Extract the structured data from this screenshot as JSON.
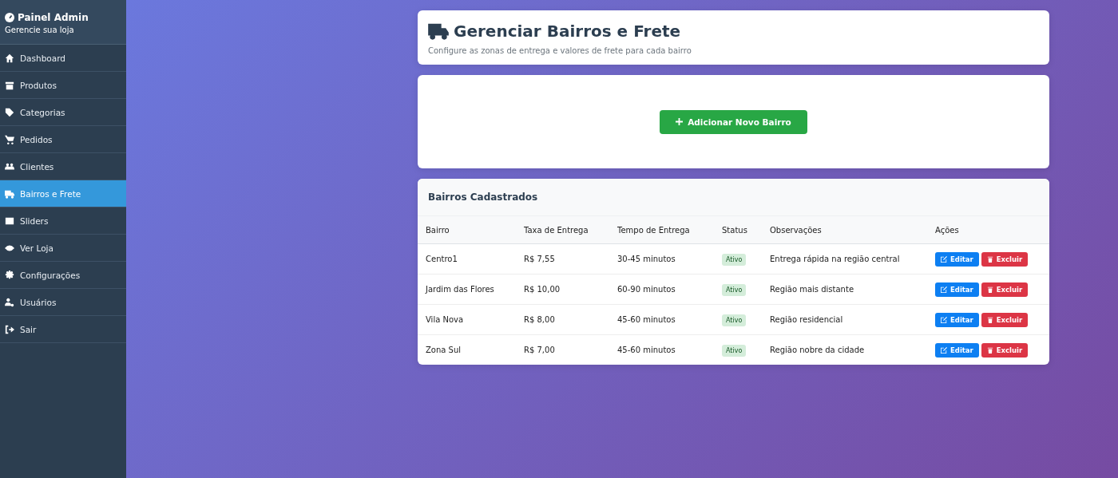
{
  "sidebar": {
    "title": "Painel Admin",
    "subtitle": "Gerencie sua loja",
    "items": [
      {
        "label": "Dashboard",
        "selected": false
      },
      {
        "label": "Produtos",
        "selected": false
      },
      {
        "label": "Categorias",
        "selected": false
      },
      {
        "label": "Pedidos",
        "selected": false
      },
      {
        "label": "Clientes",
        "selected": false
      },
      {
        "label": "Bairros e Frete",
        "selected": true
      },
      {
        "label": "Sliders",
        "selected": false
      },
      {
        "label": "Ver Loja",
        "selected": false
      },
      {
        "label": "Configurações",
        "selected": false
      },
      {
        "label": "Usuários",
        "selected": false
      },
      {
        "label": "Sair",
        "selected": false
      }
    ]
  },
  "header": {
    "title": "Gerenciar Bairros e Frete",
    "subtitle": "Configure as zonas de entrega e valores de frete para cada bairro"
  },
  "add_button": "Adicionar Novo Bairro",
  "table": {
    "title": "Bairros Cadastrados",
    "columns": [
      "Bairro",
      "Taxa de Entrega",
      "Tempo de Entrega",
      "Status",
      "Observações",
      "Ações"
    ],
    "rows": [
      {
        "bairro": "Centro1",
        "taxa": "R$ 7,55",
        "tempo": "30-45 minutos",
        "status": "Ativo",
        "active": true,
        "obs": "Entrega rápida na região central",
        "edit": "Editar",
        "delete": "Excluir"
      },
      {
        "bairro": "Jardim das Flores",
        "taxa": "R$ 10,00",
        "tempo": "60-90 minutos",
        "status": "Ativo",
        "active": true,
        "obs": "Região mais distante",
        "edit": "Editar",
        "delete": "Excluir"
      },
      {
        "bairro": "Vila Nova",
        "taxa": "R$ 8,00",
        "tempo": "45-60 minutos",
        "status": "Ativo",
        "active": true,
        "obs": "Região residencial",
        "edit": "Editar",
        "delete": "Excluir"
      },
      {
        "bairro": "Zona Sul",
        "taxa": "R$ 7,00",
        "tempo": "45-60 minutos",
        "status": "Ativo",
        "active": true,
        "obs": "Região nobre da cidade",
        "edit": "Editar",
        "delete": "Excluir"
      }
    ]
  }
}
